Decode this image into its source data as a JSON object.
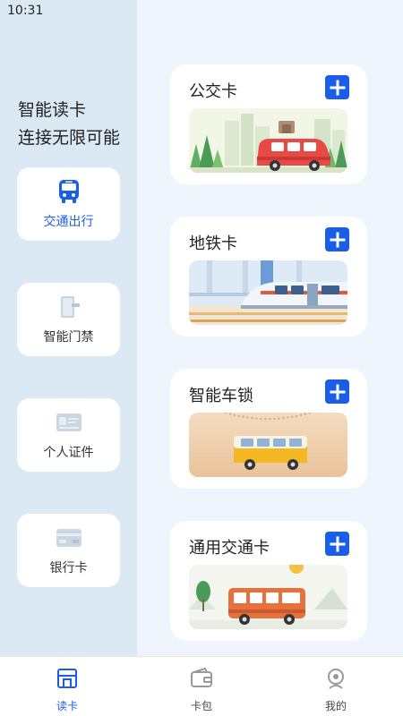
{
  "status_bar": {
    "time": "10:31"
  },
  "sidebar": {
    "slogan_line1": "智能读卡",
    "slogan_line2": "连接无限可能",
    "items": [
      {
        "label": "交通出行",
        "icon": "bus-icon",
        "active": true
      },
      {
        "label": "智能门禁",
        "icon": "door-card-icon",
        "active": false
      },
      {
        "label": "个人证件",
        "icon": "id-card-icon",
        "active": false
      },
      {
        "label": "银行卡",
        "icon": "bank-card-icon",
        "active": false
      }
    ]
  },
  "cards": [
    {
      "title": "公交卡",
      "art": "bus-city-illustration"
    },
    {
      "title": "地铁卡",
      "art": "metro-train-illustration"
    },
    {
      "title": "智能车锁",
      "art": "minibus-desert-illustration"
    },
    {
      "title": "通用交通卡",
      "art": "bus-hills-illustration"
    }
  ],
  "tab_bar": {
    "tabs": [
      {
        "label": "读卡",
        "icon": "card-reader-icon",
        "active": true
      },
      {
        "label": "卡包",
        "icon": "wallet-icon",
        "active": false
      },
      {
        "label": "我的",
        "icon": "profile-icon",
        "active": false
      }
    ]
  },
  "colors": {
    "accent": "#1a5ee8",
    "sidebar_bg": "#dbe9f5",
    "main_bg": "#eef5fc",
    "active_text": "#1f5fe0"
  }
}
